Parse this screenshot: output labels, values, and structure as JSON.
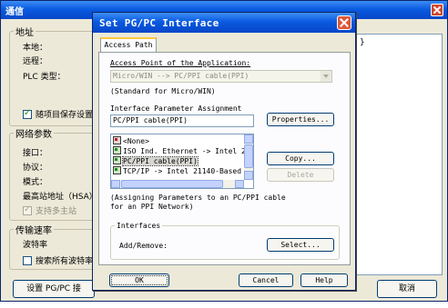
{
  "bg_window": {
    "title": "通信",
    "address_group": {
      "legend": "地址",
      "local_label": "本地：",
      "remote_label": "远程：",
      "plc_type_label": "PLC 类型：",
      "save_with_project_label": "随项目保存设置"
    },
    "network_group": {
      "legend": "网络参数",
      "interface_label": "接口：",
      "protocol_label": "协议：",
      "mode_label": "模式：",
      "highest_address_label": "最高站地址（HSA）：",
      "multi_master_label": "支持多主站"
    },
    "baud_group": {
      "legend": "传输速率",
      "baud_label": "波特率",
      "search_all_label": "搜索所有波特率"
    },
    "set_pgpc_button": "设置 PG/PC 接",
    "cancel_button": "取消",
    "right_box_text": "}"
  },
  "dialog": {
    "title": "Set PG/PC Interface",
    "tab_label": "Access Path",
    "access_point_label": "Access Point of the Application:",
    "access_point_value": "Micro/WIN       --> PC/PPI cable(PPI)",
    "access_point_note": "(Standard for Micro/WIN)",
    "param_assignment_label": "Interface Parameter Assignment",
    "param_assignment_value": "PC/PPI cable(PPI)",
    "interfaces_list": [
      {
        "label": "<None>",
        "icon": "none-interface-icon"
      },
      {
        "label": "ISO Ind. Ethernet -> Intel 2",
        "icon": "network-interface-icon"
      },
      {
        "label": "PC/PPI cable(PPI)",
        "icon": "network-interface-icon"
      },
      {
        "label": "TCP/IP -> Intel 21140-Based",
        "icon": "network-interface-icon"
      }
    ],
    "properties_button": "Properties...",
    "copy_button": "Copy...",
    "delete_button": "Delete",
    "assign_note": "(Assigning Parameters to an PC/PPI cable for an PPI Network)",
    "interfaces_group_legend": "Interfaces",
    "add_remove_label": "Add/Remove:",
    "select_button": "Select...",
    "ok_button": "OK",
    "cancel_button": "Cancel",
    "help_button": "Help"
  }
}
